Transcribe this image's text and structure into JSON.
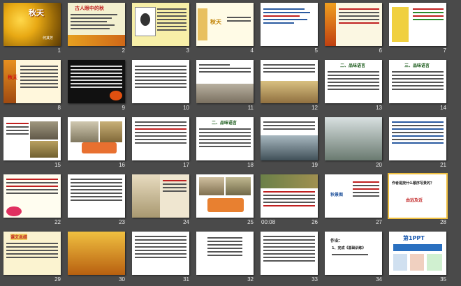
{
  "slides": [
    {
      "n": "1",
      "title": "秋天",
      "sub": "何其芳"
    },
    {
      "n": "2",
      "title": "古人眼中的秋",
      "sub": ""
    },
    {
      "n": "3",
      "title": "",
      "sub": ""
    },
    {
      "n": "4",
      "title": "秋天",
      "sub": ""
    },
    {
      "n": "5",
      "title": "",
      "sub": ""
    },
    {
      "n": "6",
      "title": "",
      "sub": ""
    },
    {
      "n": "7",
      "title": "",
      "sub": ""
    },
    {
      "n": "8",
      "title": "秋天",
      "sub": ""
    },
    {
      "n": "9",
      "title": "",
      "sub": ""
    },
    {
      "n": "10",
      "title": "",
      "sub": ""
    },
    {
      "n": "11",
      "title": "",
      "sub": ""
    },
    {
      "n": "12",
      "title": "",
      "sub": ""
    },
    {
      "n": "13",
      "title": "二、品味语言",
      "sub": ""
    },
    {
      "n": "14",
      "title": "三、品味语言",
      "sub": ""
    },
    {
      "n": "15",
      "title": "",
      "sub": ""
    },
    {
      "n": "16",
      "title": "",
      "sub": ""
    },
    {
      "n": "17",
      "title": "",
      "sub": ""
    },
    {
      "n": "18",
      "title": "二、品味语言",
      "sub": ""
    },
    {
      "n": "19",
      "title": "",
      "sub": ""
    },
    {
      "n": "20",
      "title": "",
      "sub": ""
    },
    {
      "n": "21",
      "title": "",
      "sub": ""
    },
    {
      "n": "22",
      "title": "",
      "sub": ""
    },
    {
      "n": "23",
      "title": "",
      "sub": ""
    },
    {
      "n": "24",
      "title": "",
      "sub": ""
    },
    {
      "n": "25",
      "title": "",
      "sub": ""
    },
    {
      "n": "26",
      "title": "",
      "sub": "",
      "time": "00:08"
    },
    {
      "n": "27",
      "title": "秋景图",
      "sub": ""
    },
    {
      "n": "28",
      "title": "作者是按什么顺序写景的？",
      "sub": "由远及近"
    },
    {
      "n": "29",
      "title": "课文总结",
      "sub": ""
    },
    {
      "n": "30",
      "title": "",
      "sub": ""
    },
    {
      "n": "31",
      "title": "",
      "sub": ""
    },
    {
      "n": "32",
      "title": "",
      "sub": ""
    },
    {
      "n": "33",
      "title": "",
      "sub": ""
    },
    {
      "n": "34",
      "title": "作业：",
      "sub": "1、完成《基础训练》"
    },
    {
      "n": "35",
      "title": "第1PPT",
      "sub": ""
    }
  ]
}
